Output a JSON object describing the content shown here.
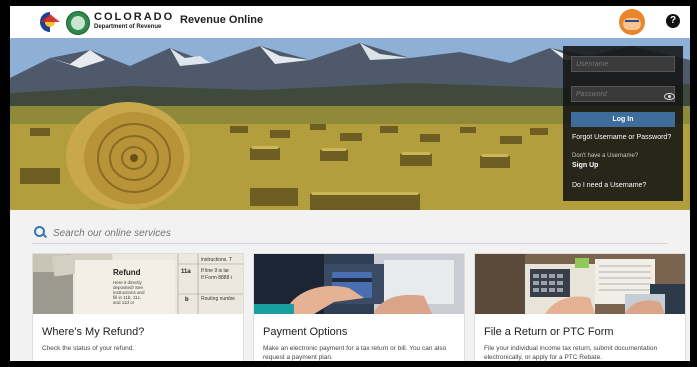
{
  "header": {
    "brand_top": "COLORADO",
    "brand_sub": "Department of Revenue",
    "app_title": "Revenue Online",
    "help_glyph": "?"
  },
  "login": {
    "username_placeholder": "Username",
    "password_placeholder": "Password",
    "login_button": "Log In",
    "forgot_link": "Forgot Username or Password?",
    "no_username": "Don't have a Username?",
    "signup_link": "Sign Up",
    "need_username_link": "Do I need a Username?"
  },
  "search": {
    "placeholder": "Search our online services"
  },
  "refund_image": {
    "heading": "Refund",
    "line1": "Here it directly",
    "line2": "deposited! See",
    "line3": "instructions and",
    "line4": "fill in 11b, 11c,",
    "line5": "and 11d or",
    "code_11a": "11a",
    "code_b": "b",
    "instr_top": "instructions. T",
    "instr_form": "If line 9 is lar",
    "instr_form2": "If Form 8888 i",
    "routing": "Routing numbe"
  },
  "cards": [
    {
      "title": "Where's My Refund?",
      "desc": "Check the status of your refund."
    },
    {
      "title": "Payment Options",
      "desc": "Make an electronic payment for a tax return or bill. You can also request a payment plan."
    },
    {
      "title": "File a Return or PTC Form",
      "desc": "File your individual income tax return, submit documentation electronically, or apply for a PTC Rebate."
    }
  ],
  "colors": {
    "accent_blue": "#3576b8",
    "login_button": "#3e6d9b",
    "login_panel": "#141414"
  },
  "icons": [
    "colorado-logo-icon",
    "state-seal-icon",
    "avatar-icon",
    "help-icon",
    "search-icon",
    "eye-icon"
  ]
}
